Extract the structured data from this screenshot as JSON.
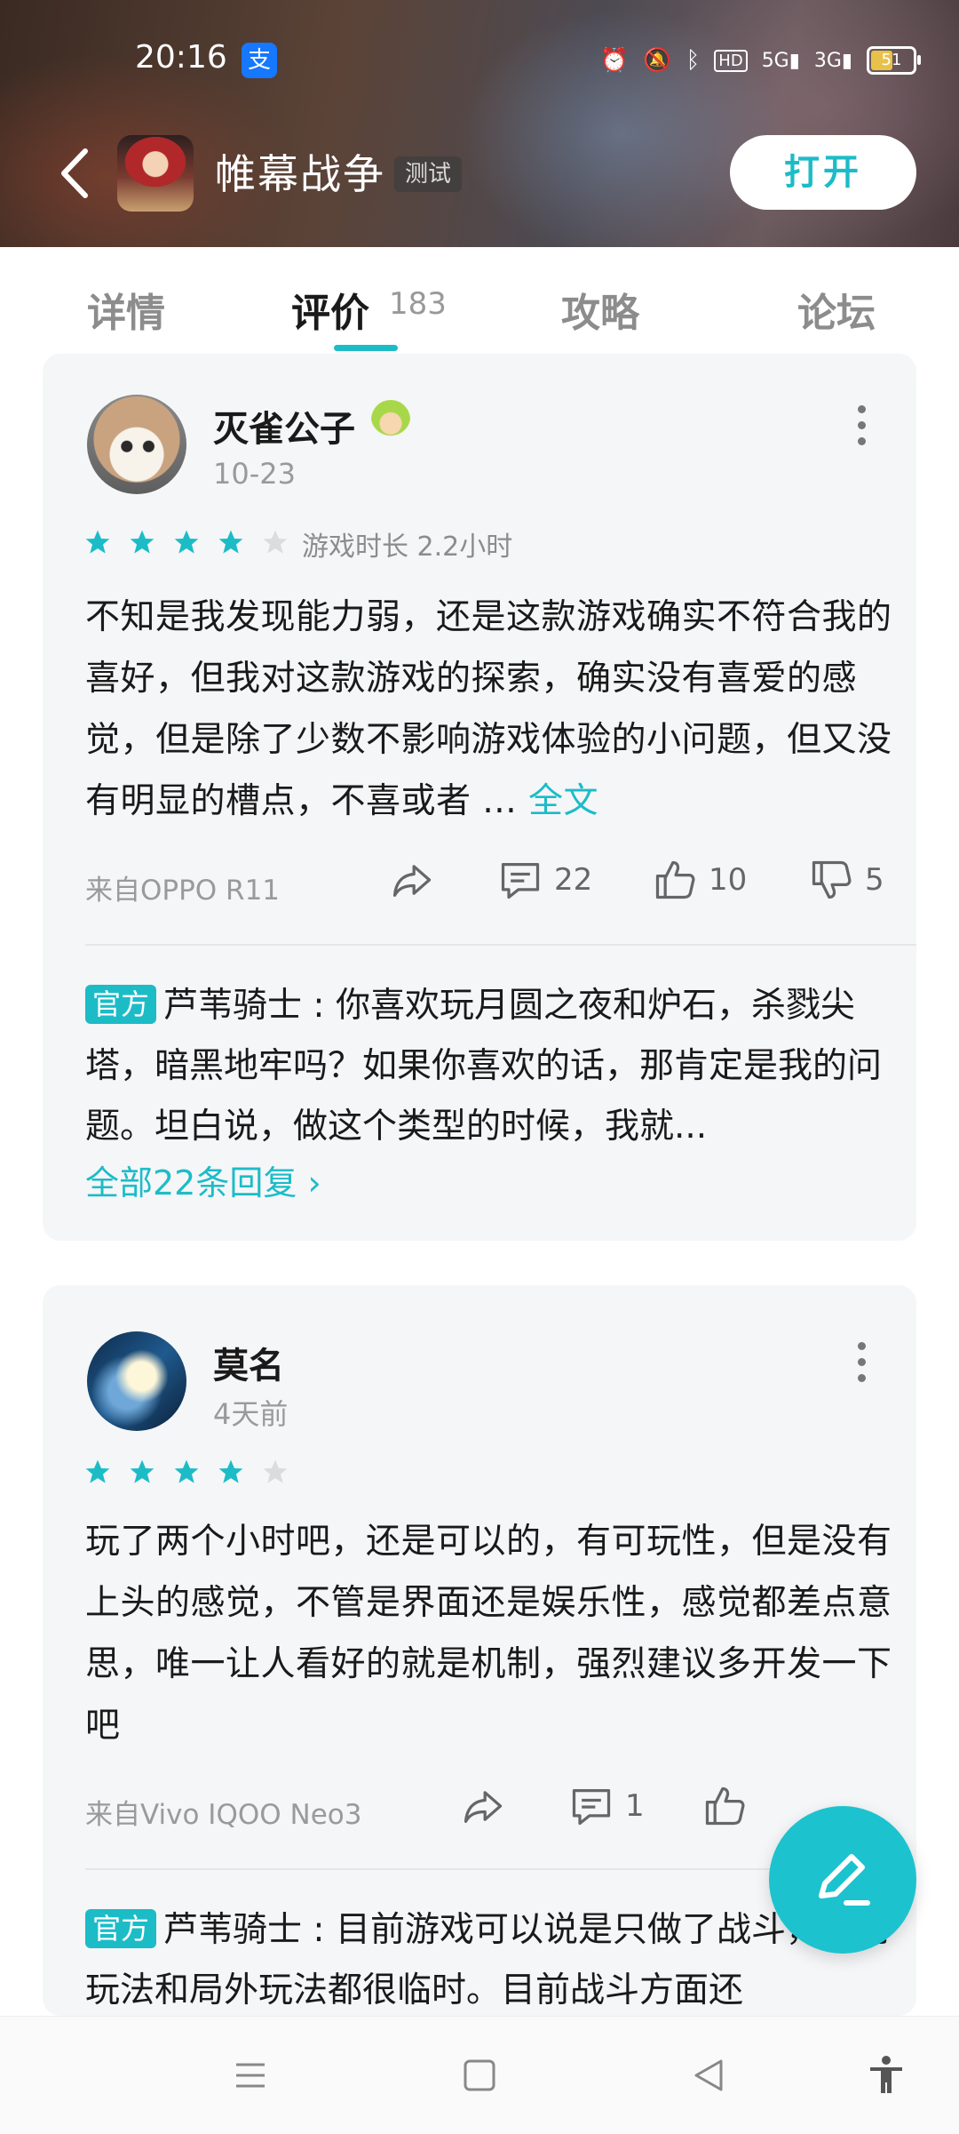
{
  "status_bar": {
    "time": "20:16",
    "alipay_glyph": "支",
    "battery": "51",
    "icons": [
      "alarm-icon",
      "mute-icon",
      "bluetooth-icon",
      "hd-icon",
      "signal-5g-icon",
      "signal-3g-icon",
      "battery-icon"
    ]
  },
  "header": {
    "title": "帷幕战争",
    "tag": "测试",
    "open_label": "打开"
  },
  "tabs": [
    {
      "label": "详情"
    },
    {
      "label": "评价",
      "count": "183",
      "active": true
    },
    {
      "label": "攻略"
    },
    {
      "label": "论坛"
    }
  ],
  "reviews": [
    {
      "username": "灭雀公子",
      "date": "10-23",
      "rating": 4,
      "playtime": "游戏时长 2.2小时",
      "text": "不知是我发现能力弱，还是这款游戏确实不符合我的喜好，但我对这款游戏的探索，确实没有喜爱的感觉，但是除了少数不影响游戏体验的小问题，但又没有明显的槽点，不喜或者 ... ",
      "more_label": "全文",
      "device": "来自OPPO R11",
      "comments": "22",
      "likes": "10",
      "dislikes": "5",
      "official": {
        "tag": "官方",
        "text": "芦苇骑士 : 你喜欢玩月圆之夜和炉石，杀戮尖塔，暗黑地牢吗？如果你喜欢的话，那肯定是我的问题。坦白说，做这个类型的时候，我就..."
      },
      "replies_label": "全部22条回复"
    },
    {
      "username": "莫名",
      "date": "4天前",
      "rating": 4,
      "text": "玩了两个小时吧，还是可以的，有可玩性，但是没有上头的感觉，不管是界面还是娱乐性，感觉都差点意思，唯一让人看好的就是机制，强烈建议多开发一下吧",
      "device": "来自Vivo IQOO Neo3",
      "comments": "1",
      "official": {
        "tag": "官方",
        "text": "芦苇骑士 : 目前游戏可以说是只做了战斗，局内玩法和局外玩法都很临时。目前战斗方面还"
      }
    }
  ],
  "colors": {
    "accent": "#1cbcc7",
    "star_filled": "#1cbcc7",
    "star_empty": "#dcdcdc",
    "card_bg": "#f5f6f8"
  }
}
